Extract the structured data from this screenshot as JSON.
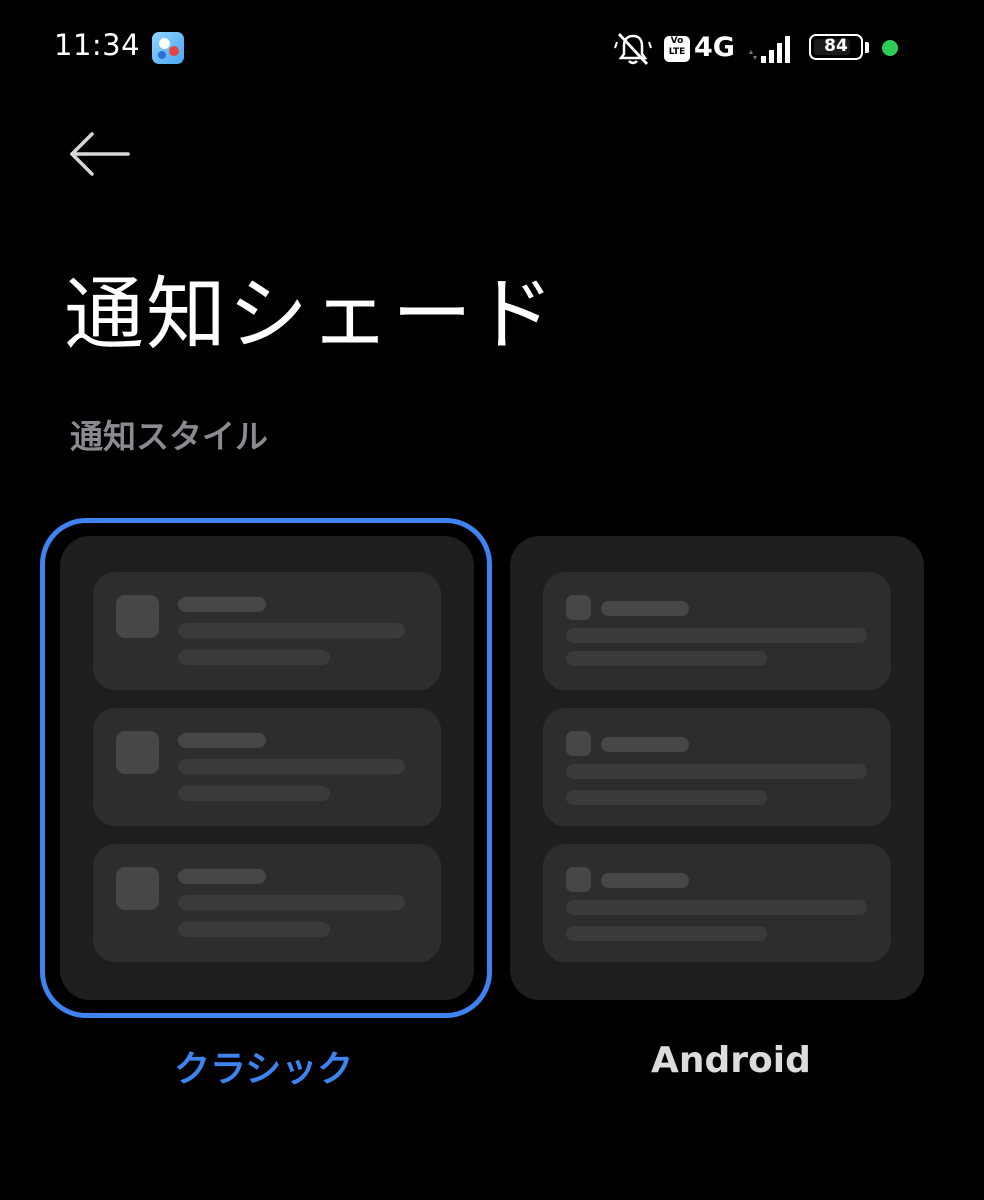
{
  "status_bar": {
    "time": "11:34",
    "network_type": "4G",
    "volte_label": "Vo\nLTE",
    "battery_level": "84",
    "battery_fraction": 0.84,
    "dot_color": "#2ecc55",
    "icons": [
      "app-notification-icon",
      "mute-icon",
      "volte-icon",
      "signal-icon",
      "battery-icon"
    ]
  },
  "header": {
    "back_icon": "arrow-left-icon",
    "title": "通知シェード"
  },
  "section": {
    "label": "通知スタイル"
  },
  "styles": {
    "selected": "classic",
    "accent_color": "#3d84f0",
    "options": [
      {
        "id": "classic",
        "label": "クラシック"
      },
      {
        "id": "android",
        "label": "Android"
      }
    ]
  }
}
